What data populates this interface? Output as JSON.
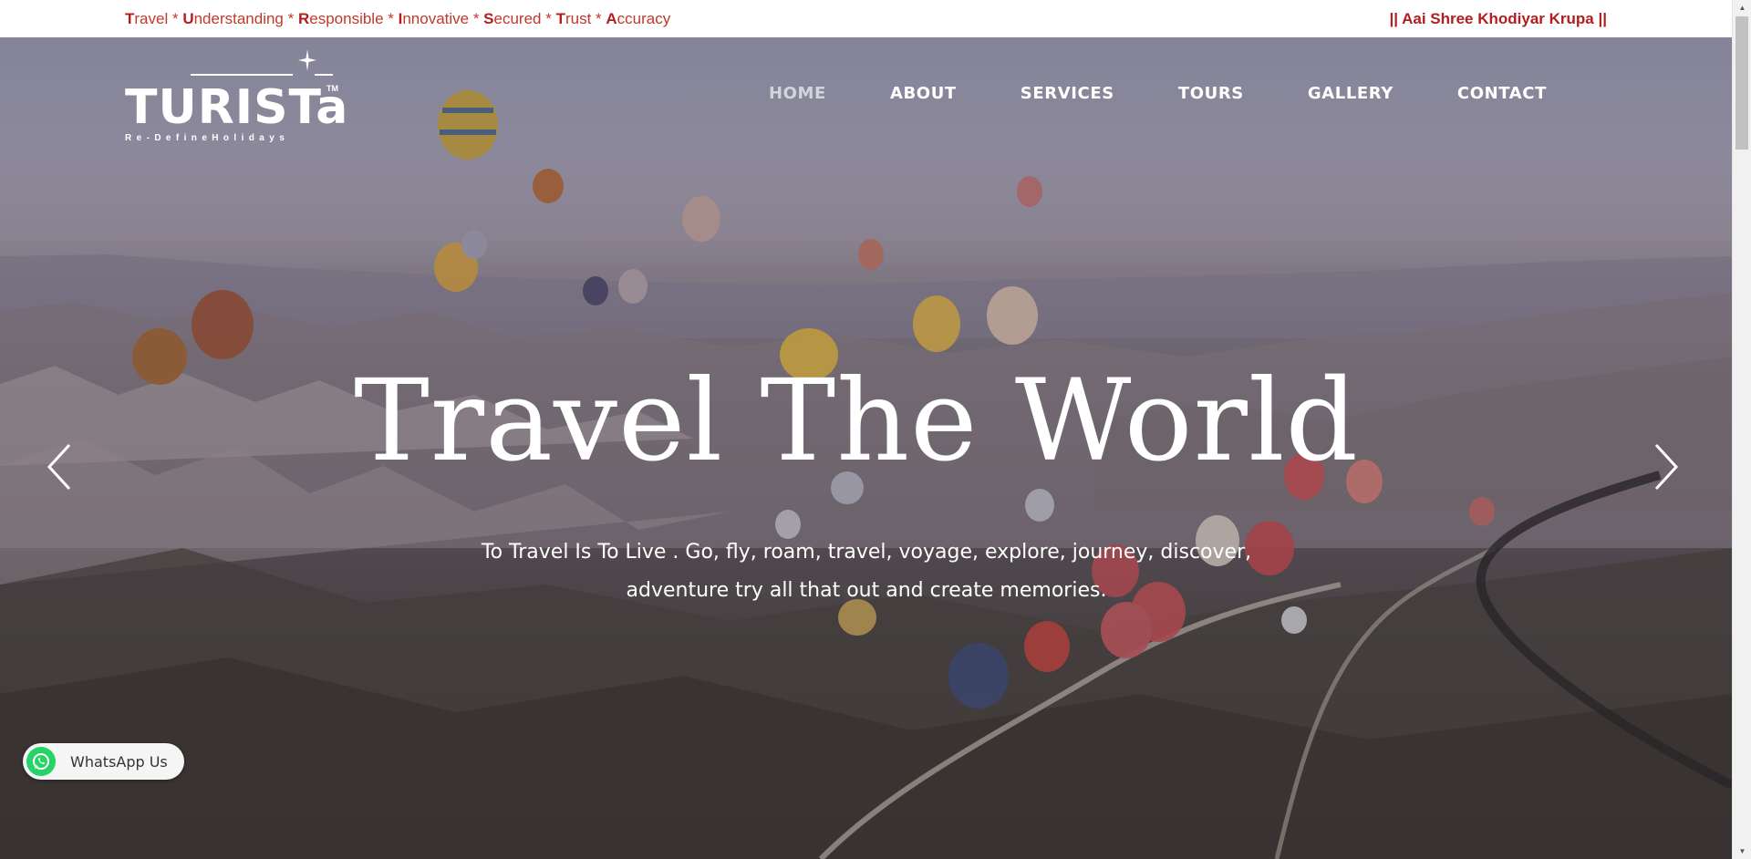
{
  "topbar": {
    "tagline": [
      {
        "cap": "T",
        "rest": "ravel * "
      },
      {
        "cap": "U",
        "rest": "nderstanding * "
      },
      {
        "cap": "R",
        "rest": "esponsible * "
      },
      {
        "cap": "I",
        "rest": "nnovative * "
      },
      {
        "cap": "S",
        "rest": "ecured * "
      },
      {
        "cap": "T",
        "rest": "rust * "
      },
      {
        "cap": "A",
        "rest": "ccuracy"
      }
    ],
    "blessing": "|| Aai Shree Khodiyar Krupa ||"
  },
  "logo": {
    "word": "TURISTa",
    "tm": "TM",
    "subtitle": "Re-DefineHolidays"
  },
  "nav": {
    "items": [
      {
        "label": "HOME",
        "active": true
      },
      {
        "label": "ABOUT",
        "active": false
      },
      {
        "label": "SERVICES",
        "active": false
      },
      {
        "label": "TOURS",
        "active": false
      },
      {
        "label": "GALLERY",
        "active": false
      },
      {
        "label": "CONTACT",
        "active": false
      }
    ]
  },
  "hero": {
    "title": "Travel The World",
    "subtitle": "To Travel Is To Live . Go, fly, roam, travel, voyage, explore, journey, discover, adventure try all that out and create memories.",
    "prev_icon": "chevron-left-icon",
    "next_icon": "chevron-right-icon"
  },
  "whatsapp": {
    "label": "WhatsApp Us",
    "icon": "whatsapp-icon"
  },
  "colors": {
    "topbar_text": "#c0392b",
    "topbar_caps": "#b01e1e",
    "nav_text": "#ffffff",
    "nav_active": "#d4d4dc",
    "whatsapp_green": "#25d366"
  }
}
